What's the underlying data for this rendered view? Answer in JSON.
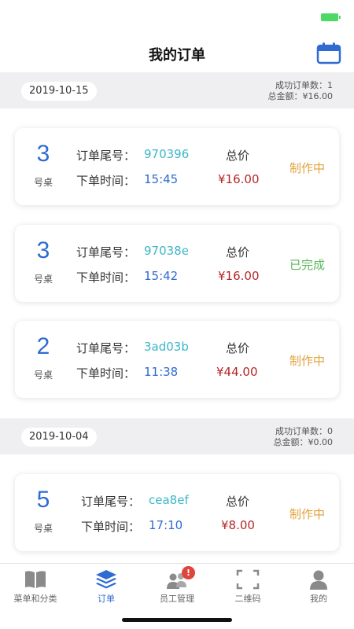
{
  "nav": {
    "title": "我的订单"
  },
  "groups": [
    {
      "date": "2019-10-15",
      "success_count": "成功订单数：1",
      "total_amount": "总金额：¥16.00",
      "orders": [
        {
          "table": "3",
          "table_suffix": "号桌",
          "id_label": "订单尾号：",
          "id": "970396",
          "time_label": "下单时间：",
          "time": "15:45",
          "total_label": "总价",
          "price": "¥16.00",
          "status": "制作中",
          "status_color": "#e0a23b"
        },
        {
          "table": "3",
          "table_suffix": "号桌",
          "id_label": "订单尾号：",
          "id": "97038e",
          "time_label": "下单时间：",
          "time": "15:42",
          "total_label": "总价",
          "price": "¥16.00",
          "status": "已完成",
          "status_color": "#5cb85c"
        },
        {
          "table": "2",
          "table_suffix": "号桌",
          "id_label": "订单尾号：",
          "id": "3ad03b",
          "time_label": "下单时间：",
          "time": "11:38",
          "total_label": "总价",
          "price": "¥44.00",
          "status": "制作中",
          "status_color": "#e0a23b"
        }
      ]
    },
    {
      "date": "2019-10-04",
      "success_count": "成功订单数：0",
      "total_amount": "总金额：¥0.00",
      "orders": [
        {
          "table": "5",
          "table_suffix": "号桌",
          "id_label": "订单尾号：",
          "id": "cea8ef",
          "time_label": "下单时间：",
          "time": "17:10",
          "total_label": "总价",
          "price": "¥8.00",
          "status": "制作中",
          "status_color": "#e0a23b"
        }
      ]
    }
  ],
  "tabs": [
    {
      "label": "菜单和分类",
      "icon": "book-icon"
    },
    {
      "label": "订单",
      "icon": "layers-icon",
      "active": true
    },
    {
      "label": "员工管理",
      "icon": "staff-icon",
      "badge": "!"
    },
    {
      "label": "二维码",
      "icon": "qr-scan-icon"
    },
    {
      "label": "我的",
      "icon": "person-icon"
    }
  ]
}
